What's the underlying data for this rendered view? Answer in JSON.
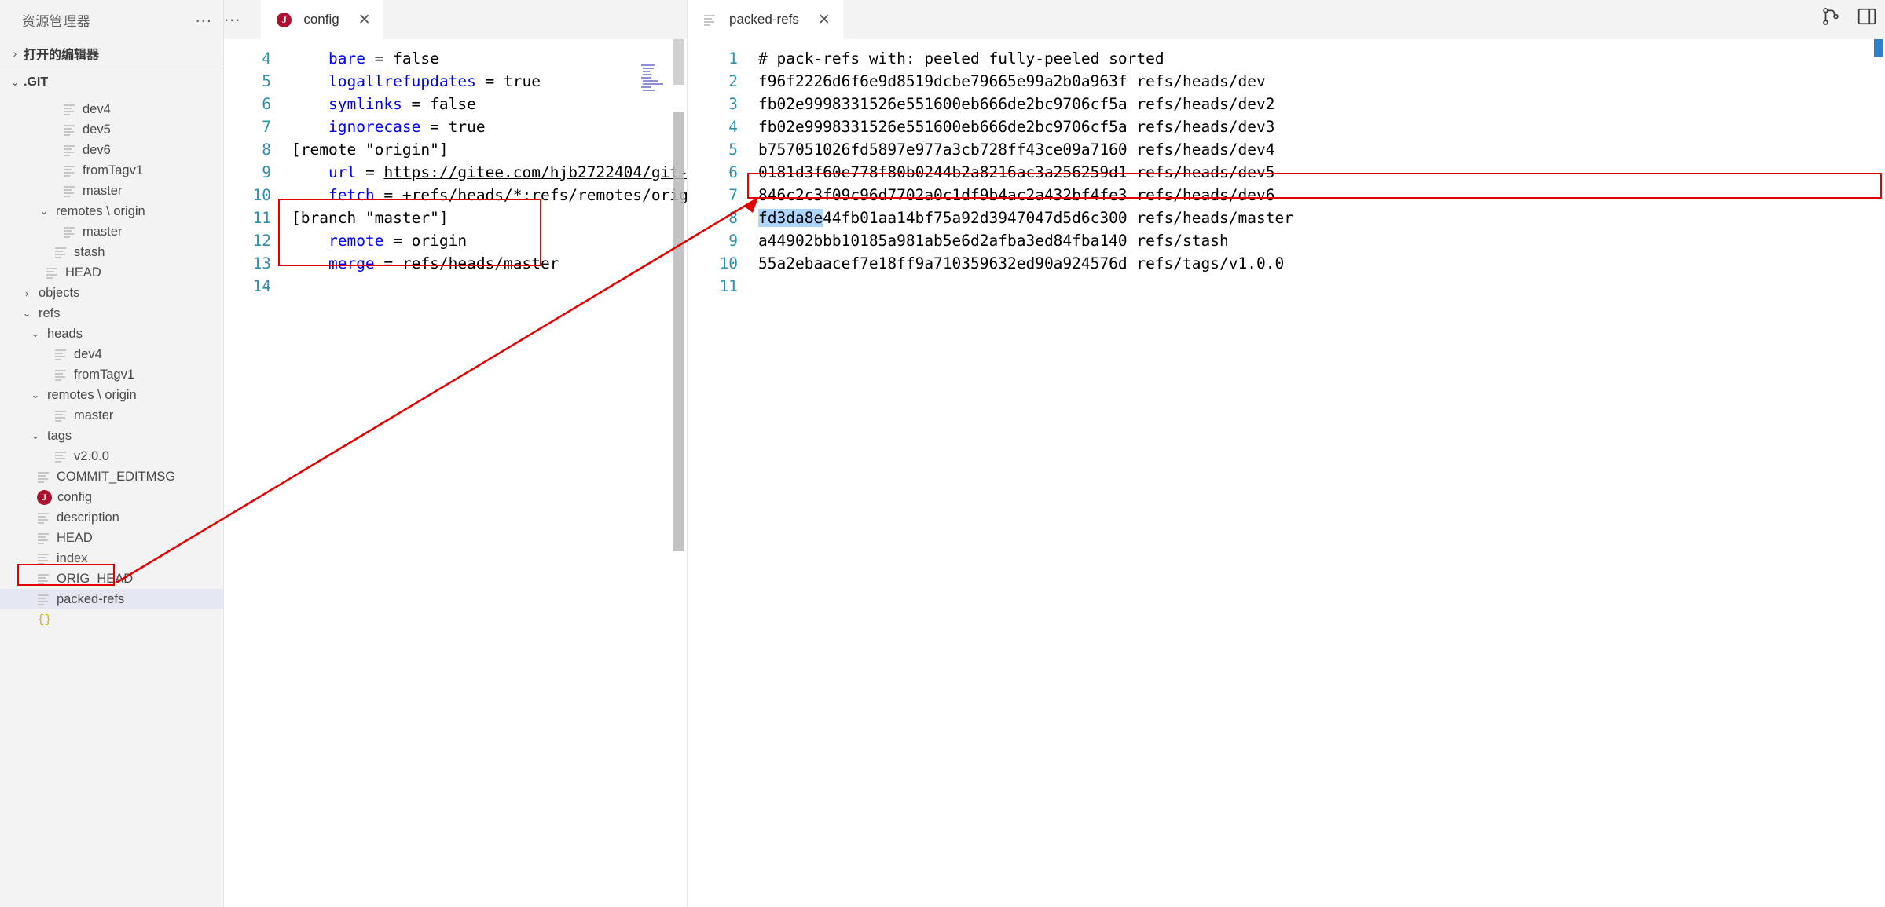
{
  "sidebar": {
    "title": "资源管理器",
    "dots_label": "...",
    "sections": [
      {
        "label": "打开的编辑器",
        "chevron": "›",
        "expanded": false
      },
      {
        "label": ".GIT",
        "chevron": "⌄",
        "expanded": true
      }
    ],
    "tree": [
      {
        "label": "dev4",
        "indent": 2,
        "icon": "file-lines-icon",
        "twisty": "",
        "selected": false
      },
      {
        "label": "dev5",
        "indent": 2,
        "icon": "file-lines-icon",
        "twisty": "",
        "selected": false
      },
      {
        "label": "dev6",
        "indent": 2,
        "icon": "file-lines-icon",
        "twisty": "",
        "selected": false
      },
      {
        "label": "fromTagv1",
        "indent": 2,
        "icon": "file-lines-icon",
        "twisty": "",
        "selected": false
      },
      {
        "label": "master",
        "indent": 2,
        "icon": "file-lines-icon",
        "twisty": "",
        "selected": false
      },
      {
        "label": "remotes \\ origin",
        "indent": 1.5,
        "icon": "none",
        "twisty": "⌄",
        "selected": false
      },
      {
        "label": "master",
        "indent": 2,
        "icon": "file-lines-icon",
        "twisty": "",
        "selected": false
      },
      {
        "label": "stash",
        "indent": 1.5,
        "icon": "file-lines-icon",
        "twisty": "",
        "selected": false
      },
      {
        "label": "HEAD",
        "indent": 1,
        "icon": "file-lines-icon",
        "twisty": "",
        "selected": false
      },
      {
        "label": "objects",
        "indent": 0.5,
        "icon": "none",
        "twisty": "›",
        "selected": false
      },
      {
        "label": "refs",
        "indent": 0.5,
        "icon": "none",
        "twisty": "⌄",
        "selected": false
      },
      {
        "label": "heads",
        "indent": 1,
        "icon": "none",
        "twisty": "⌄",
        "selected": false
      },
      {
        "label": "dev4",
        "indent": 1.5,
        "icon": "file-lines-icon",
        "twisty": "",
        "selected": false
      },
      {
        "label": "fromTagv1",
        "indent": 1.5,
        "icon": "file-lines-icon",
        "twisty": "",
        "selected": false
      },
      {
        "label": "remotes \\ origin",
        "indent": 1,
        "icon": "none",
        "twisty": "⌄",
        "selected": false
      },
      {
        "label": "master",
        "indent": 1.5,
        "icon": "file-lines-icon",
        "twisty": "",
        "selected": false
      },
      {
        "label": "tags",
        "indent": 1,
        "icon": "none",
        "twisty": "⌄",
        "selected": false
      },
      {
        "label": "v2.0.0",
        "indent": 1.5,
        "icon": "file-lines-icon",
        "twisty": "",
        "selected": false
      },
      {
        "label": "COMMIT_EDITMSG",
        "indent": 0.5,
        "icon": "file-lines-icon",
        "twisty": "",
        "selected": false
      },
      {
        "label": "config",
        "indent": 0.5,
        "icon": "j-badge-icon",
        "twisty": "",
        "selected": false
      },
      {
        "label": "description",
        "indent": 0.5,
        "icon": "file-lines-icon",
        "twisty": "",
        "selected": false
      },
      {
        "label": "HEAD",
        "indent": 0.5,
        "icon": "file-lines-icon",
        "twisty": "",
        "selected": false
      },
      {
        "label": "index",
        "indent": 0.5,
        "icon": "file-lines-icon",
        "twisty": "",
        "selected": false
      },
      {
        "label": "ORIG_HEAD",
        "indent": 0.5,
        "icon": "file-lines-icon",
        "twisty": "",
        "selected": false
      },
      {
        "label": "packed-refs",
        "indent": 0.5,
        "icon": "file-lines-icon",
        "twisty": "",
        "selected": true
      },
      {
        "label": "",
        "indent": 0.5,
        "icon": "braces-icon",
        "twisty": "",
        "selected": false
      }
    ]
  },
  "left_pane": {
    "tab": {
      "label": "config",
      "icon": "j-badge-icon",
      "close": "✕"
    },
    "dots_label": "...",
    "line_numbers": [
      "4",
      "5",
      "6",
      "7",
      "8",
      "9",
      "10",
      "11",
      "12",
      "13",
      "14"
    ],
    "lines": [
      {
        "num": "4",
        "indent": true,
        "key": "bare",
        "eq": " = ",
        "val": "false"
      },
      {
        "num": "5",
        "indent": true,
        "key": "logallrefupdates",
        "eq": " = ",
        "val": "true"
      },
      {
        "num": "6",
        "indent": true,
        "key": "symlinks",
        "eq": " = ",
        "val": "false"
      },
      {
        "num": "7",
        "indent": true,
        "key": "ignorecase",
        "eq": " = ",
        "val": "true"
      },
      {
        "num": "8",
        "indent": false,
        "section": "[remote \"origin\"]"
      },
      {
        "num": "9",
        "indent": true,
        "key": "url",
        "eq": " = ",
        "val": "https://gitee.com/hjb2722404/git-",
        "underline": true
      },
      {
        "num": "10",
        "indent": true,
        "key": "fetch",
        "eq": " = ",
        "val": "+refs/heads/*:refs/remotes/orig"
      },
      {
        "num": "11",
        "indent": false,
        "section": "[branch \"master\"]"
      },
      {
        "num": "12",
        "indent": true,
        "key": "remote",
        "eq": " = ",
        "val": "origin"
      },
      {
        "num": "13",
        "indent": true,
        "key": "merge",
        "eq": " = ",
        "val": "refs/heads/master"
      },
      {
        "num": "14",
        "indent": false,
        "section": ""
      }
    ]
  },
  "right_pane": {
    "tab": {
      "label": "packed-refs",
      "icon": "file-lines-icon",
      "close": "✕"
    },
    "lines": [
      {
        "num": "1",
        "text": "# pack-refs with: peeled fully-peeled sorted"
      },
      {
        "num": "2",
        "text": "f96f2226d6f6e9d8519dcbe79665e99a2b0a963f refs/heads/dev"
      },
      {
        "num": "3",
        "text": "fb02e9998331526e551600eb666de2bc9706cf5a refs/heads/dev2"
      },
      {
        "num": "4",
        "text": "fb02e9998331526e551600eb666de2bc9706cf5a refs/heads/dev3"
      },
      {
        "num": "5",
        "text": "b757051026fd5897e977a3cb728ff43ce09a7160 refs/heads/dev4"
      },
      {
        "num": "6",
        "text": "0181d3f60e778f80b0244b2a8216ac3a256259d1 refs/heads/dev5"
      },
      {
        "num": "7",
        "text": "846c2c3f09c96d7702a0c1df9b4ac2a432bf4fe3 refs/heads/dev6"
      },
      {
        "num": "8",
        "hl": "fd3da8e",
        "text": "44fb01aa14bf75a92d3947047d5d6c300 refs/heads/master"
      },
      {
        "num": "9",
        "text": "a44902bbb10185a981ab5e6d2afba3ed84fba140 refs/stash"
      },
      {
        "num": "10",
        "text": "55a2ebaacef7e18ff9a710359632ed90a924576d refs/tags/v1.0.0"
      },
      {
        "num": "11",
        "text": ""
      }
    ]
  },
  "title_actions": [
    {
      "name": "source-control-icon"
    },
    {
      "name": "split-layout-icon"
    }
  ],
  "colors": {
    "annotation": "#e50000",
    "keyword": "#0000ff",
    "line_number": "#2b91af",
    "selection": "#add6ff",
    "sidebar_bg": "#f3f3f3",
    "selected_row": "#e4e6f1"
  }
}
